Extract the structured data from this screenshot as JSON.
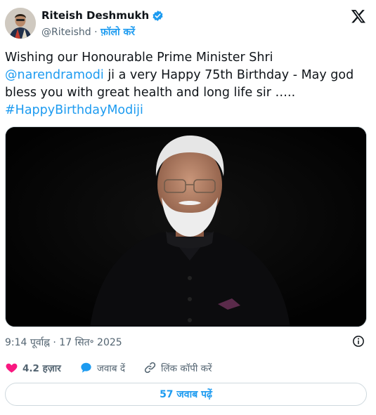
{
  "author": {
    "name": "Riteish Deshmukh",
    "handle": "@Riteishd",
    "separator": "·",
    "follow_label": "फ़ॉलो करें"
  },
  "tweet": {
    "text_line1": "Wishing our Honourable Prime Minister  Shri",
    "mention": "@narendramodi",
    "text_line2_rest": " ji a very Happy 75th Birthday - May god",
    "text_line3": "bless you with great health and long life sir …..",
    "hashtag": "#HappyBirthdayModiji"
  },
  "meta": {
    "time_date": "9:14 पूर्वाह्न · 17 सित॰ 2025"
  },
  "actions": {
    "likes_count": "4.2 हज़ार",
    "reply_label": "जवाब दें",
    "copy_link_label": "लिंक कॉपी करें"
  },
  "replies_button": "57 जवाब पढ़ें",
  "colors": {
    "accent": "#1d9bf0",
    "like": "#f91880",
    "text": "#0f1419",
    "secondary": "#536471"
  }
}
